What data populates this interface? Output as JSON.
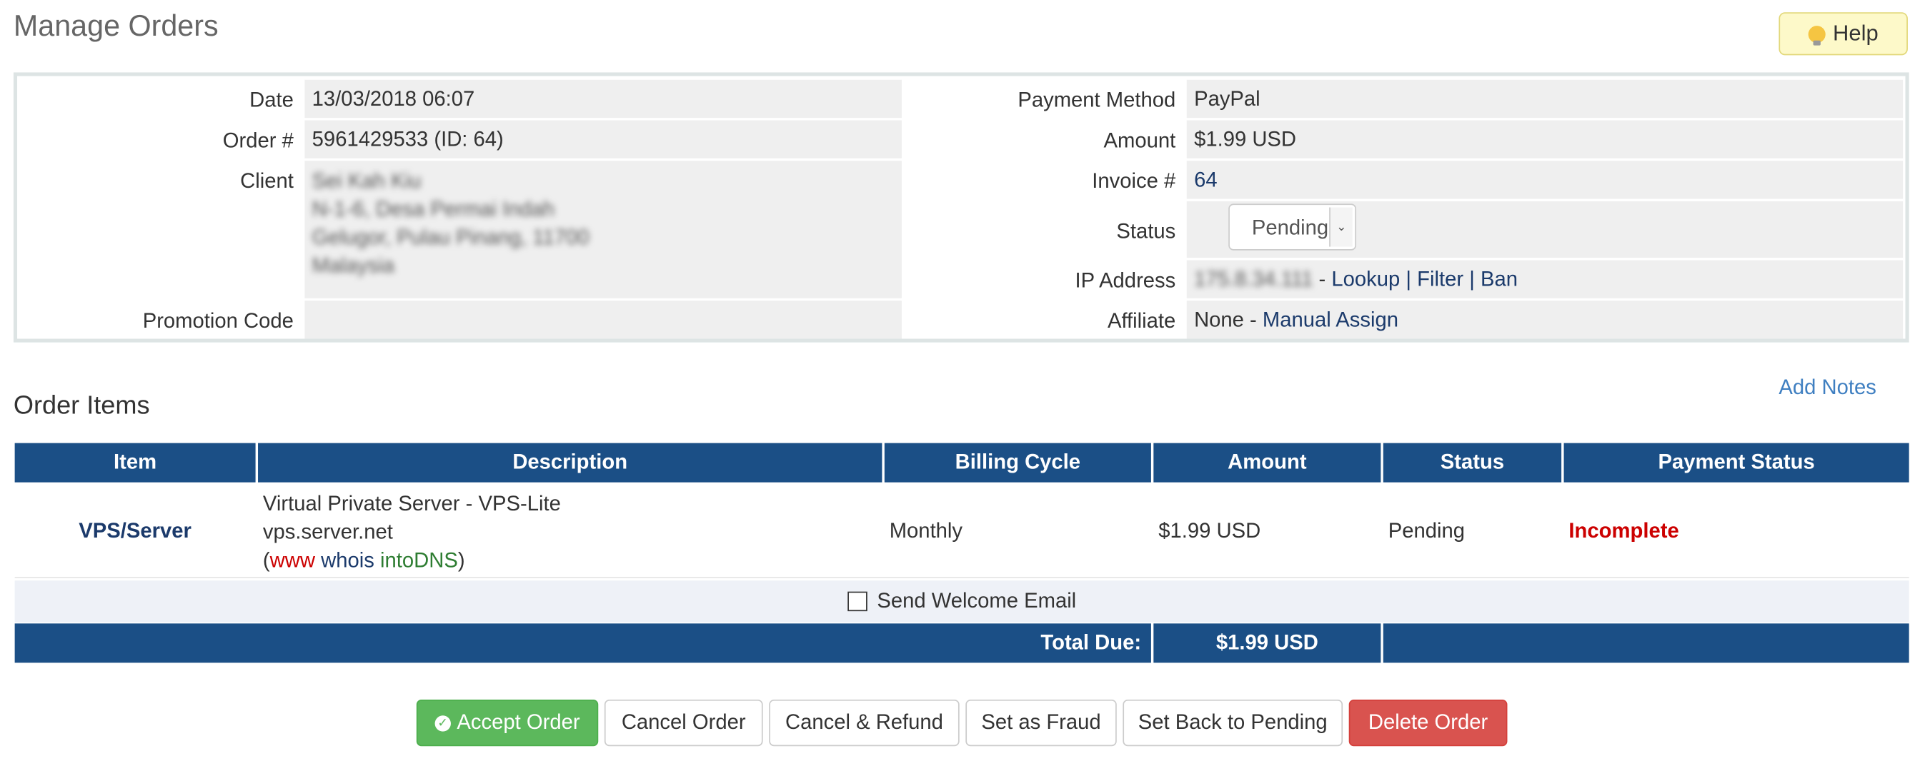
{
  "page": {
    "title": "Manage Orders",
    "help_label": "Help"
  },
  "summary": {
    "date_label": "Date",
    "date": "13/03/2018 06:07",
    "order_label": "Order #",
    "order": "5961429533 (ID: 64)",
    "client_label": "Client",
    "client_lines": [
      "Sei Kah Kiu",
      "N-1-6, Desa Permai Indah",
      "Gelugor, Pulau Pinang, 11700",
      "Malaysia"
    ],
    "promo_label": "Promotion Code",
    "promo": "",
    "payment_label": "Payment Method",
    "payment": "PayPal",
    "amount_label": "Amount",
    "amount": "$1.99 USD",
    "invoice_label": "Invoice #",
    "invoice": "64",
    "status_label": "Status",
    "status": "Pending",
    "ip_label": "IP Address",
    "ip": "175.8.34.111",
    "ip_sep": " - ",
    "ip_lookup": "Lookup",
    "pipe": " | ",
    "ip_filter": "Filter",
    "ip_ban": "Ban",
    "affiliate_label": "Affiliate",
    "affiliate_none": "None - ",
    "affiliate_assign": "Manual Assign"
  },
  "items": {
    "title": "Order Items",
    "add_notes": "Add Notes",
    "headers": [
      "Item",
      "Description",
      "Billing Cycle",
      "Amount",
      "Status",
      "Payment Status"
    ],
    "row": {
      "item": "VPS/Server",
      "desc1": "Virtual Private Server - VPS-Lite",
      "desc2": "vps.server.net",
      "paren_open": "(",
      "www": "www",
      "whois": "whois",
      "intodns": "intoDNS",
      "paren_close": ")",
      "cycle": "Monthly",
      "amount": "$1.99 USD",
      "status": "Pending",
      "payment_status": "Incomplete"
    },
    "send_welcome": "Send Welcome Email",
    "total_label": "Total Due:",
    "total_amount": "$1.99 USD"
  },
  "actions": {
    "accept": "Accept Order",
    "cancel": "Cancel Order",
    "cancel_refund": "Cancel & Refund",
    "fraud": "Set as Fraud",
    "pending": "Set Back to Pending",
    "delete": "Delete Order"
  },
  "colors": {
    "header_blue": "#1b4f86",
    "accept_green": "#5cb85c",
    "delete_red": "#d9534f",
    "incomplete_red": "#cc0000",
    "link_blue": "#1b3a6b"
  }
}
